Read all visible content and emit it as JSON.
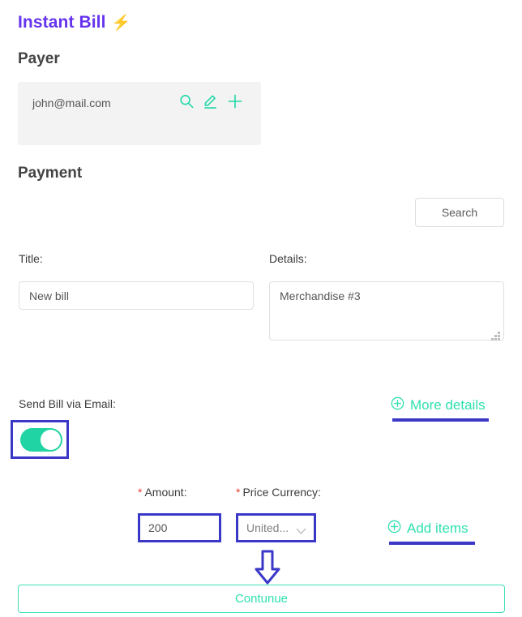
{
  "app": {
    "title": "Instant Bill",
    "title_emoji": "⚡"
  },
  "payer": {
    "heading": "Payer",
    "email": "john@mail.com",
    "actions": [
      {
        "icon": "search-icon"
      },
      {
        "icon": "edit-pencil-icon"
      },
      {
        "icon": "plus-icon"
      }
    ]
  },
  "payment": {
    "heading": "Payment",
    "search_label": "Search",
    "title_field": {
      "label": "Title:",
      "value": "New bill"
    },
    "details_field": {
      "label": "Details:",
      "value": "Merchandise #3"
    },
    "send_email": {
      "label": "Send Bill via Email:",
      "toggle_state": "on"
    },
    "more_details_label": "More details",
    "amount_field": {
      "label": "Amount:",
      "required_marker": "*",
      "value": "200"
    },
    "currency_field": {
      "label": "Price Currency:",
      "required_marker": "*",
      "value": "United..."
    },
    "add_items_label": "Add items",
    "continue_label": "Contunue"
  },
  "colors": {
    "brand_purple": "#6633ee",
    "accent_teal": "#2fe0ae",
    "toggle_green": "#21d4a3",
    "highlight_blue": "#3b38c8",
    "required_red": "#e8413a",
    "bolt_yellow": "#f5c518"
  }
}
